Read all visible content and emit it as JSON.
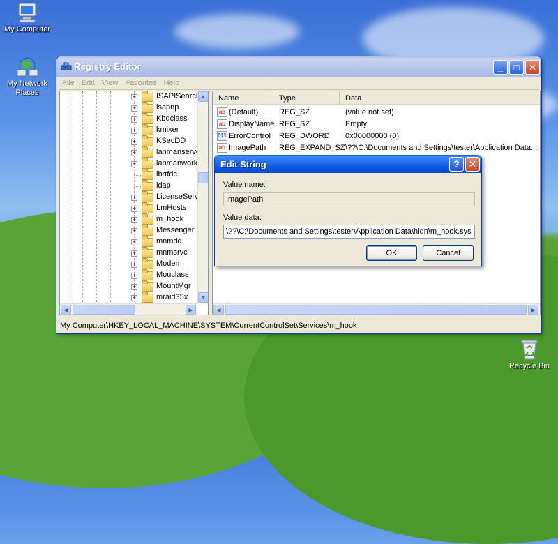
{
  "desktop": {
    "icons": [
      {
        "label": "My Computer"
      },
      {
        "label": "My Network Places"
      },
      {
        "label": "Recycle Bin"
      }
    ]
  },
  "window": {
    "title": "Registry Editor",
    "menu": [
      "File",
      "Edit",
      "View",
      "Favorites",
      "Help"
    ],
    "tree_items": [
      "ISAPISearch",
      "isapnp",
      "Kbdclass",
      "kmixer",
      "KSecDD",
      "lanmanserve",
      "lanmanwork",
      "lbrtfdc",
      "ldap",
      "LicenseServ",
      "LmHosts",
      "m_hook",
      "Messenger",
      "mnmdd",
      "mnmsrvc",
      "Modem",
      "Mouclass",
      "MountMgr",
      "mraid35x"
    ],
    "columns": [
      "Name",
      "Type",
      "Data"
    ],
    "values": [
      {
        "icon": "ab",
        "name": "(Default)",
        "type": "REG_SZ",
        "data": "(value not set)"
      },
      {
        "icon": "ab",
        "name": "DisplayName",
        "type": "REG_SZ",
        "data": "Empty"
      },
      {
        "icon": "011",
        "name": "ErrorControl",
        "type": "REG_DWORD",
        "data": "0x00000000 (0)"
      },
      {
        "icon": "ab",
        "name": "ImagePath",
        "type": "REG_EXPAND_SZ",
        "data": "\\??\\C:\\Documents and Settings\\tester\\Application Data..."
      }
    ],
    "status": "My Computer\\HKEY_LOCAL_MACHINE\\SYSTEM\\CurrentControlSet\\Services\\m_hook"
  },
  "dialog": {
    "title": "Edit String",
    "help_glyph": "?",
    "close_glyph": "✕",
    "value_name_label": "Value name:",
    "value_name": "ImagePath",
    "value_data_label": "Value data:",
    "value_data": "\\??\\C:\\Documents and Settings\\tester\\Application Data\\hidn\\m_hook.sys",
    "ok_label": "OK",
    "cancel_label": "Cancel"
  },
  "colors": {
    "titlebar_active": "#0a5fe8",
    "titlebar_inactive": "#a9bae4",
    "chrome": "#ece9d8",
    "selection": "#316ac5"
  },
  "icons": [
    "computer-icon",
    "network-icon",
    "recycle-bin-icon",
    "registry-icon",
    "folder-icon",
    "string-value-icon",
    "binary-value-icon"
  ]
}
